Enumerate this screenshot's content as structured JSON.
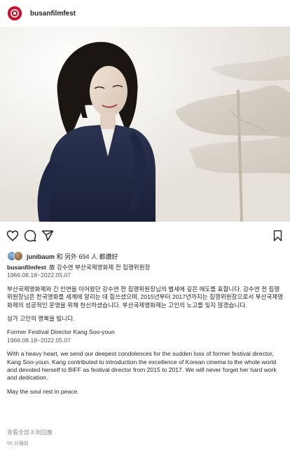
{
  "post": {
    "username": "busanfilmfest",
    "avatar_icon": "busan-film-festival-logo-icon",
    "photo_alt": "black-and-white portrait of a woman in a dark dress"
  },
  "actions": {
    "like_icon": "heart-icon",
    "comment_icon": "comment-icon",
    "share_icon": "send-icon",
    "save_icon": "bookmark-icon"
  },
  "likes": {
    "user": "junibaum",
    "rest": " 和 另外 694 人 都讚好"
  },
  "caption": {
    "owner": "busanfilmfest",
    "title": "故 강수연 부산국제영화제 전 집행위원장",
    "dates_ko": "1966.08.18~2022.05.07",
    "para1_ko": "부산국제영화제와 긴 인연을 이어왔던 강수연 전 집행위원장님의 별세에 깊은 애도를 표합니다. 강수연 전 집행위원장님은 한국영화를 세계에 알리는 데 힘쓰셨으며, 2015년부터 2017년까지는 집행위원장으로서 부산국제영화제의 성공적인 운영을 위해 헌신하셨습니다. 부산국제영화제는 고인의 노고를 잊지 않겠습니다.",
    "para2_ko": "삼가 고인의 명복을 빕니다.",
    "title_en": "Former Festival Director Kang Soo-youn",
    "dates_en": "1966.08.18~2022.05.07",
    "para1_en": "With a heavy heart, we send our deepest condolences for the sudden loss of former festival director, Kang Soo-youn. Kang contributed to introduction the excellence of Korean cinema to the whole world and devoted herself to BIFF as festival director from 2015 to 2017. We will never forget her hard work and dedication.",
    "para2_en": "May the soul rest in peace."
  },
  "footer": {
    "comments_link": "查看全部 8 則回應",
    "timestamp": "55 分鐘前"
  },
  "colors": {
    "brand": "#c8102e",
    "text": "#262626",
    "muted": "#8e8e8e"
  }
}
